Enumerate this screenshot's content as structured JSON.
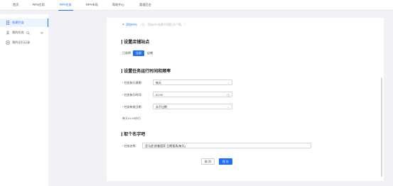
{
  "topnav": {
    "items": [
      {
        "label": "首页",
        "active": false
      },
      {
        "label": "RPA应用",
        "active": false
      },
      {
        "label": "RPA任务",
        "active": true
      },
      {
        "label": "RPA市场",
        "active": false
      },
      {
        "label": "帮助中心",
        "active": false
      },
      {
        "label": "管理后台",
        "active": false
      }
    ]
  },
  "sidebar": {
    "items": [
      {
        "label": "创建任务",
        "active": true
      },
      {
        "label": "我的任务",
        "active": false
      },
      {
        "label": "我的运行记录",
        "active": false
      }
    ]
  },
  "main": {
    "add_rpa": {
      "label": "添加RPA",
      "hint": "（注：添加RPA依赖不同超过3个哦。）"
    },
    "store_section": {
      "title": "设置店铺站点",
      "prefix": "已选择",
      "options": [
        "全部",
        "店铺"
      ],
      "selected": "全部"
    },
    "schedule_section": {
      "title": "设置任务运行时间和频率",
      "fields": [
        {
          "label": "任务执行周期：",
          "value": "每天",
          "required": true,
          "suffix": "chevron-down-icon"
        },
        {
          "label": "任务执行时间：",
          "value": "01:00",
          "required": true,
          "suffix": "clock-icon"
        },
        {
          "label": "任务有效日期：",
          "value": "永不过期",
          "required": true,
          "suffix": "chevron-down-icon"
        }
      ],
      "summary": "每天01:00执行"
    },
    "name_section": {
      "title": "取个名字吧",
      "field_label": "任务名称：",
      "field_value": "亚马逊 欧鲁国家 日期报表(每天)",
      "required": true
    },
    "buttons": {
      "cancel": "取 消",
      "save": "保 存"
    }
  },
  "colors": {
    "accent": "#1f6fff",
    "required": "#f5222d"
  }
}
